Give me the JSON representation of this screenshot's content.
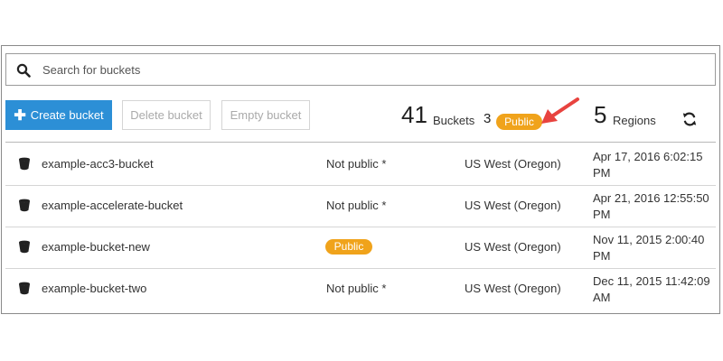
{
  "search": {
    "placeholder": "Search for buckets",
    "value": ""
  },
  "toolbar": {
    "create_label": "Create bucket",
    "delete_label": "Delete bucket",
    "empty_label": "Empty bucket"
  },
  "stats": {
    "buckets_count": "41",
    "buckets_label": "Buckets",
    "public_count": "3",
    "public_label": "Public",
    "regions_count": "5",
    "regions_label": "Regions"
  },
  "colors": {
    "accent": "#2c8fd6",
    "public_badge": "#f0a31b",
    "arrow": "#e8433f"
  },
  "buckets": [
    {
      "name": "example-acc3-bucket",
      "access": "Not public *",
      "access_public": false,
      "region": "US West (Oregon)",
      "date": "Apr 17, 2016 6:02:15 PM"
    },
    {
      "name": "example-accelerate-bucket",
      "access": "Not public *",
      "access_public": false,
      "region": "US West (Oregon)",
      "date": "Apr 21, 2016 12:55:50 PM"
    },
    {
      "name": "example-bucket-new",
      "access": "Public",
      "access_public": true,
      "region": "US West (Oregon)",
      "date": "Nov 11, 2015 2:00:40 PM"
    },
    {
      "name": "example-bucket-two",
      "access": "Not public *",
      "access_public": false,
      "region": "US West (Oregon)",
      "date": "Dec 11, 2015 11:42:09 AM"
    }
  ]
}
